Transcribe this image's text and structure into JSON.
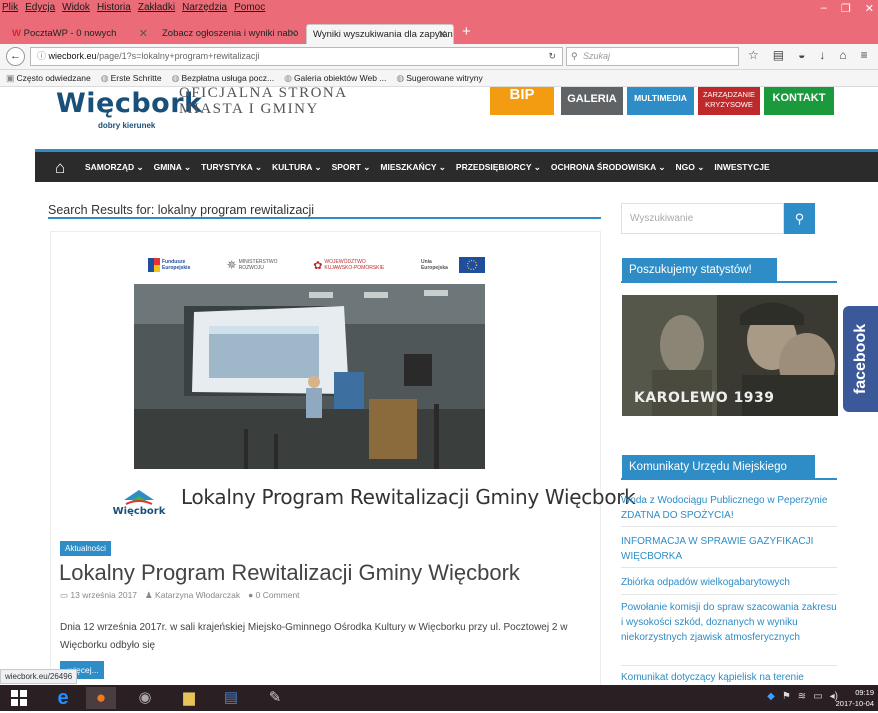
{
  "browser": {
    "menu": [
      "Plik",
      "Edycja",
      "Widok",
      "Historia",
      "Zakładki",
      "Narzędzia",
      "Pomoc"
    ],
    "tabs": [
      {
        "label": "PocztaWP - 0 nowych"
      },
      {
        "label": "Zobacz ogłoszenia i wyniki nabo"
      },
      {
        "label": "Wyniki wyszukiwania dla zapytan"
      }
    ],
    "url_domain": "wiecbork.eu",
    "url_path": "/page/1?s=lokalny+program+rewitalizacji",
    "search_placeholder": "Szukaj",
    "bookmarks": [
      "Często odwiedzane",
      "Erste Schritte",
      "Bezpłatna usługa pocz...",
      "Galeria obiektów Web ...",
      "Sugerowane witryny"
    ],
    "status_url": "wiecbork.eu/26496"
  },
  "site": {
    "logo": "Więcbork",
    "logo_tagline": "dobry kierunek",
    "title_line1": "Oficjalna strona",
    "title_line2": "Miasta i Gminy",
    "top_buttons": [
      "BIP",
      "GALERIA",
      "MULTIMEDIA",
      "ZARZĄDZANIE",
      "KRYZYSOWE",
      "KONTAKT"
    ],
    "nav": [
      "SAMORZĄD",
      "GMINA",
      "TURYSTYKA",
      "KULTURA",
      "SPORT",
      "MIESZKAŃCY",
      "PRZEDSIĘBIORCY",
      "OCHRONA ŚRODOWISKA",
      "NGO",
      "INWESTYCJE"
    ],
    "chevron": "⌄"
  },
  "results": {
    "heading": "Search Results for: lokalny program rewitalizacji",
    "sponsors": [
      "Fundusze Europejskie",
      "MINISTERSTWO ROZWOJU",
      "WOJEWÓDZTWO KUJAWSKO-POMORSKIE",
      "Unia Europejska"
    ],
    "plan_logo": "Więcbork",
    "plan_title": "Lokalny Program Rewitalizacji Gminy Więcbork",
    "category": "Aktualności",
    "post_title": "Lokalny Program Rewitalizacji Gminy Więcbork",
    "date": "13 września 2017",
    "author": "Katarzyna Włodarczak",
    "comments": "0 Comment",
    "excerpt": "Dnia 12 września 2017r. w sali krajeńskiej  Miejsko-Gminnego Ośrodka Kultury w Więcborku przy  ul. Pocztowej 2 w Więcborku odbyło się",
    "more": "więcej..."
  },
  "sidebar": {
    "search_placeholder": "Wyszukiwanie",
    "widget1_title": "Poszukujemy statystów!",
    "poster_title": "KAROLEWO 1939",
    "widget2_title": "Komunikaty Urzędu Miejskiego",
    "news": [
      "Woda z Wodociągu Publicznego w Peperzynie ZDATNA DO SPOŻYCIA!",
      "INFORMACJA W SPRAWIE GAZYFIKACJI WIĘCBORKA",
      "Zbiórka odpadów wielkogabarytowych",
      "Powołanie komisji do spraw szacowania zakresu i wysokości szkód, doznanych w wyniku niekorzystnych zjawisk atmosferycznych",
      "Komunikat dotyczący kąpielisk na terenie"
    ],
    "facebook": "facebook"
  },
  "taskbar": {
    "time": "09:19",
    "date": "2017-10-04"
  },
  "colors": {
    "accent": "#2e8dc6",
    "bip": "#f39c12",
    "galeria": "#5f6366",
    "multimedia": "#2e8dc6",
    "kryzys": "#c0292b",
    "kontakt": "#1a9a3d"
  }
}
